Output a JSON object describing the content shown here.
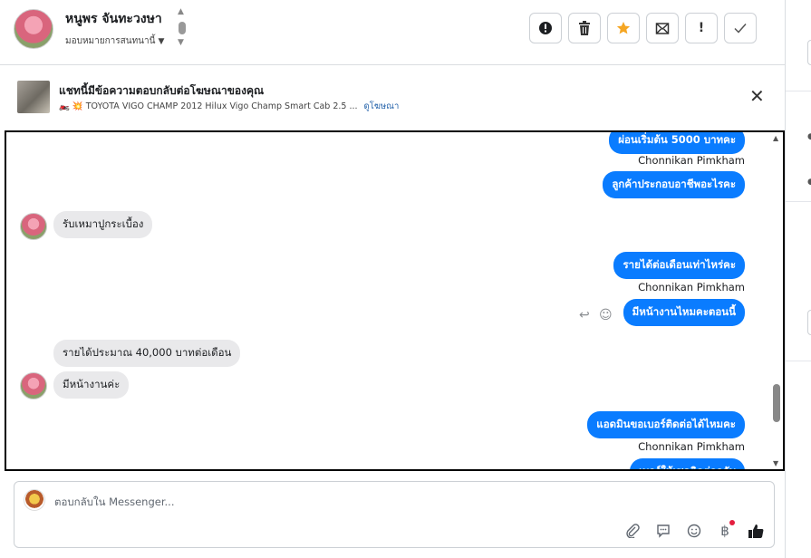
{
  "header": {
    "contact_name": "หนูพร จันทะวงษา",
    "assign_label": "มอบหมายการสนทนานี้",
    "toolbar": [
      {
        "name": "spam-button",
        "icon": "alert-circle-icon"
      },
      {
        "name": "delete-button",
        "icon": "trash-icon"
      },
      {
        "name": "star-button",
        "icon": "star-icon"
      },
      {
        "name": "unread-button",
        "icon": "envelope-icon"
      },
      {
        "name": "important-button",
        "icon": "exclamation-icon",
        "glyph": "!"
      },
      {
        "name": "done-button",
        "icon": "check-icon"
      }
    ]
  },
  "ad": {
    "title": "แชทนี้มีข้อความตอบกลับต่อโฆษณาของคุณ",
    "emoji": "🏍️ 💥",
    "description": "TOYOTA VIGO CHAMP 2012 Hilux Vigo Champ Smart Cab 2.5 ...",
    "link": "ดูโฆษณา"
  },
  "messages": [
    {
      "type": "out",
      "text": "ผ่อนเริ่มต้น 5000 บาทคะ"
    },
    {
      "type": "sender",
      "text": "Chonnikan Pimkham"
    },
    {
      "type": "out",
      "text": "ลูกค้าประกอบอาชีพอะไรคะ"
    },
    {
      "type": "in",
      "text": "รับเหมาปูกระเบื้อง"
    },
    {
      "type": "out",
      "text": "รายได้ต่อเดือนเท่าไหร่คะ"
    },
    {
      "type": "sender",
      "text": "Chonnikan Pimkham"
    },
    {
      "type": "out",
      "text": "มีหน้างานไหมคะตอนนี้"
    },
    {
      "type": "in",
      "text": "รายได้ประมาณ 40,000 บาทต่อเดือน"
    },
    {
      "type": "in",
      "text": "มีหน้างานค่ะ"
    },
    {
      "type": "out",
      "text": "แอดมินขอเบอร์ติดต่อได้ไหมคะ"
    },
    {
      "type": "sender",
      "text": "Chonnikan Pimkham"
    },
    {
      "type": "out",
      "text": "เบอร์ให้เซลติดต่อกลับ"
    }
  ],
  "composer": {
    "placeholder": "ตอบกลับใน Messenger...",
    "tools": [
      "paperclip-icon",
      "quick-reply-icon",
      "emoji-icon",
      "baht-payment-icon",
      "thumbs-up-icon"
    ]
  },
  "colors": {
    "outgoing_bubble": "#0a7cff",
    "incoming_bubble": "#e9e9eb",
    "star": "#f5a623"
  }
}
